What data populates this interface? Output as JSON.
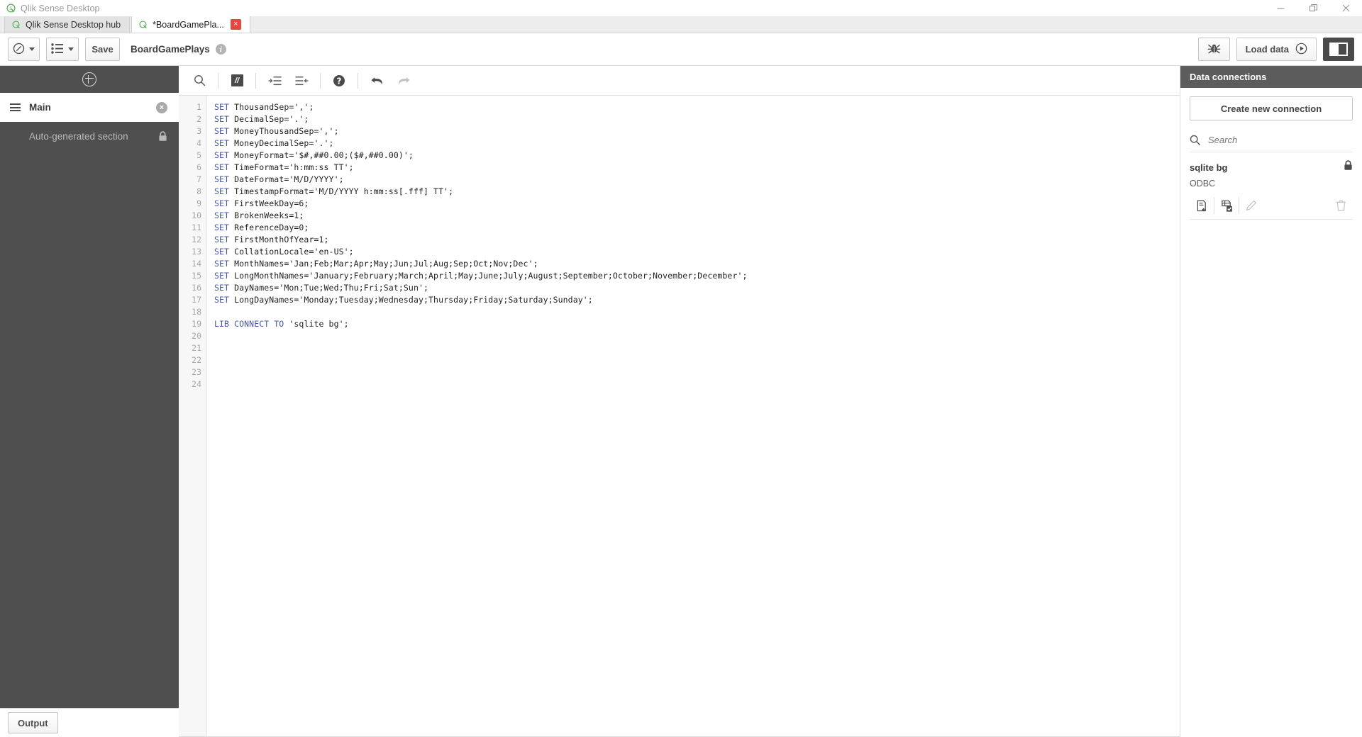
{
  "window": {
    "title": "Qlik Sense Desktop",
    "app_icon": "qlik-logo-icon",
    "minimize_label": "—",
    "maximize_label": "❐",
    "close_label": "×"
  },
  "tabs": [
    {
      "label": "Qlik Sense Desktop hub",
      "icon": "qlik-logo-icon",
      "active": false,
      "closable": false
    },
    {
      "label": "*BoardGamePla...",
      "icon": "qlik-logo-icon",
      "active": true,
      "closable": true,
      "close_label": "×"
    }
  ],
  "toolbar": {
    "nav_icon": "compass-icon",
    "sheets_icon": "sheet-list-icon",
    "save_label": "Save",
    "app_name": "BoardGamePlays",
    "info_label": "i",
    "debug_icon": "debug-bug-icon",
    "load_data_label": "Load data",
    "load_data_icon": "play-circle-icon",
    "panel_toggle_icon": "toggle-right-panel-icon"
  },
  "editor_toolbar": {
    "search_icon": "search-icon",
    "comment_icon": "comment-icon",
    "comment_label": "//",
    "indent_icon": "indent-icon",
    "outdent_icon": "outdent-icon",
    "help_icon": "help-circle-icon",
    "undo_icon": "undo-arrow-icon",
    "redo_icon": "redo-arrow-icon"
  },
  "sidebar": {
    "add_label": "+",
    "add_icon": "plus-circle-icon",
    "sections": [
      {
        "label": "Main",
        "active": true,
        "icon": "drag-handle-icon",
        "trailing_icon": "close-circle-icon",
        "trailing_label": "×"
      },
      {
        "label": "Auto-generated section",
        "active": false,
        "locked": true,
        "trailing_icon": "lock-icon"
      }
    ],
    "output_label": "Output"
  },
  "script": {
    "line_numbers": [
      1,
      2,
      3,
      4,
      5,
      6,
      7,
      8,
      9,
      10,
      11,
      12,
      13,
      14,
      15,
      16,
      17,
      18,
      19,
      20,
      21,
      22,
      23,
      24
    ],
    "lines": [
      {
        "keyword": "SET",
        "rest": " ThousandSep=',';"
      },
      {
        "keyword": "SET",
        "rest": " DecimalSep='.';"
      },
      {
        "keyword": "SET",
        "rest": " MoneyThousandSep=',';"
      },
      {
        "keyword": "SET",
        "rest": " MoneyDecimalSep='.';"
      },
      {
        "keyword": "SET",
        "rest": " MoneyFormat='$#,##0.00;($#,##0.00)';"
      },
      {
        "keyword": "SET",
        "rest": " TimeFormat='h:mm:ss TT';"
      },
      {
        "keyword": "SET",
        "rest": " DateFormat='M/D/YYYY';"
      },
      {
        "keyword": "SET",
        "rest": " TimestampFormat='M/D/YYYY h:mm:ss[.fff] TT';"
      },
      {
        "keyword": "SET",
        "rest": " FirstWeekDay=6;"
      },
      {
        "keyword": "SET",
        "rest": " BrokenWeeks=1;"
      },
      {
        "keyword": "SET",
        "rest": " ReferenceDay=0;"
      },
      {
        "keyword": "SET",
        "rest": " FirstMonthOfYear=1;"
      },
      {
        "keyword": "SET",
        "rest": " CollationLocale='en-US';"
      },
      {
        "keyword": "SET",
        "rest": " MonthNames='Jan;Feb;Mar;Apr;May;Jun;Jul;Aug;Sep;Oct;Nov;Dec';"
      },
      {
        "keyword": "SET",
        "rest": " LongMonthNames='January;February;March;April;May;June;July;August;September;October;November;December';"
      },
      {
        "keyword": "SET",
        "rest": " DayNames='Mon;Tue;Wed;Thu;Fri;Sat;Sun';"
      },
      {
        "keyword": "SET",
        "rest": " LongDayNames='Monday;Tuesday;Wednesday;Thursday;Friday;Saturday;Sunday';"
      },
      {
        "keyword": "",
        "rest": ""
      },
      {
        "keyword": "LIB CONNECT TO",
        "rest": " 'sqlite bg';"
      },
      {
        "keyword": "",
        "rest": ""
      },
      {
        "keyword": "",
        "rest": ""
      },
      {
        "keyword": "",
        "rest": ""
      },
      {
        "keyword": "",
        "rest": ""
      },
      {
        "keyword": "",
        "rest": ""
      }
    ]
  },
  "right_panel": {
    "title": "Data connections",
    "create_label": "Create new connection",
    "search_placeholder": "Search",
    "search_value": "",
    "search_icon": "search-icon",
    "connections": [
      {
        "name": "sqlite bg",
        "type": "ODBC",
        "locked": true,
        "lock_icon": "lock-icon",
        "actions": [
          {
            "icon": "insert-script-icon",
            "disabled": false
          },
          {
            "icon": "select-data-icon",
            "disabled": false
          },
          {
            "icon": "edit-pencil-icon",
            "disabled": true
          },
          {
            "icon": "delete-trash-icon",
            "disabled": true
          }
        ]
      }
    ]
  },
  "colors": {
    "qlik_green": "#4cae4c",
    "sidebar_bg": "#4f4f4f",
    "panel_header_bg": "#5c5c5c",
    "keyword_blue": "#4457b5",
    "close_red": "#e8453c"
  }
}
